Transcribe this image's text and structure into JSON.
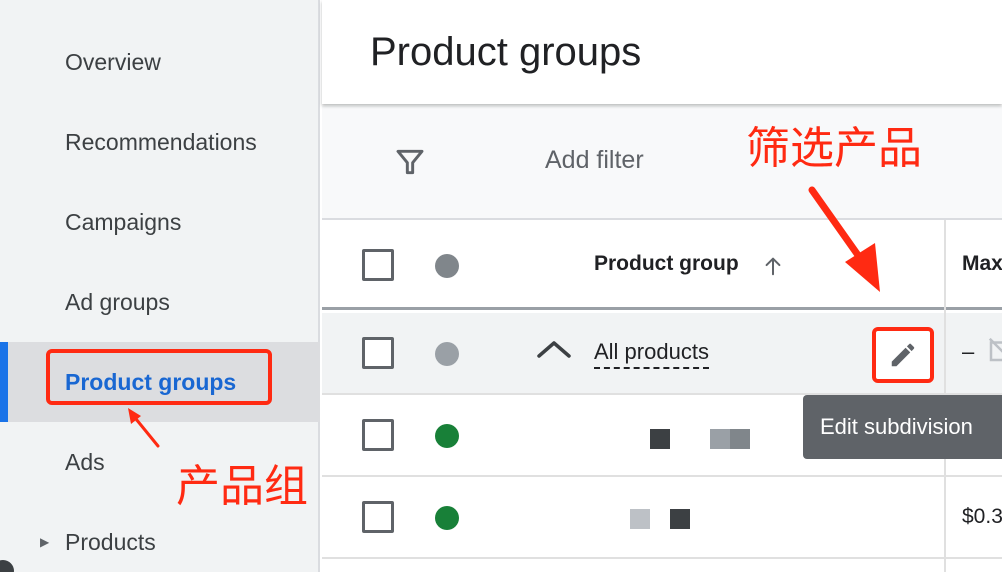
{
  "sidebar": {
    "items": [
      {
        "label": "Overview"
      },
      {
        "label": "Recommendations"
      },
      {
        "label": "Campaigns"
      },
      {
        "label": "Ad groups"
      },
      {
        "label": "Product groups",
        "active": true
      },
      {
        "label": "Ads"
      },
      {
        "label": "Products",
        "expandable": true
      }
    ]
  },
  "main": {
    "title": "Product groups",
    "filter": {
      "icon": "filter-icon",
      "label": "Add filter"
    },
    "table": {
      "headers": {
        "product_group": "Product group",
        "max_cpc_partial": "Max"
      },
      "sort_icon": "arrow-up-icon",
      "rows": [
        {
          "status": "gray",
          "name": "All products",
          "expand_icon": "chevron-up-icon",
          "edit_icon": "pencil-icon",
          "bid": "–"
        },
        {
          "status": "green",
          "name": "",
          "bid": ""
        },
        {
          "status": "green",
          "name": "",
          "bid": "$0.3"
        }
      ]
    },
    "tooltip": "Edit subdivision"
  },
  "annotations": {
    "filter_products": "筛选产品",
    "product_group": "产品组"
  },
  "colors": {
    "accent": "#1a73e8",
    "active_text": "#1967d2",
    "status_green": "#188038",
    "annotation_red": "#ff2a12",
    "tooltip_bg": "#5f6368"
  }
}
